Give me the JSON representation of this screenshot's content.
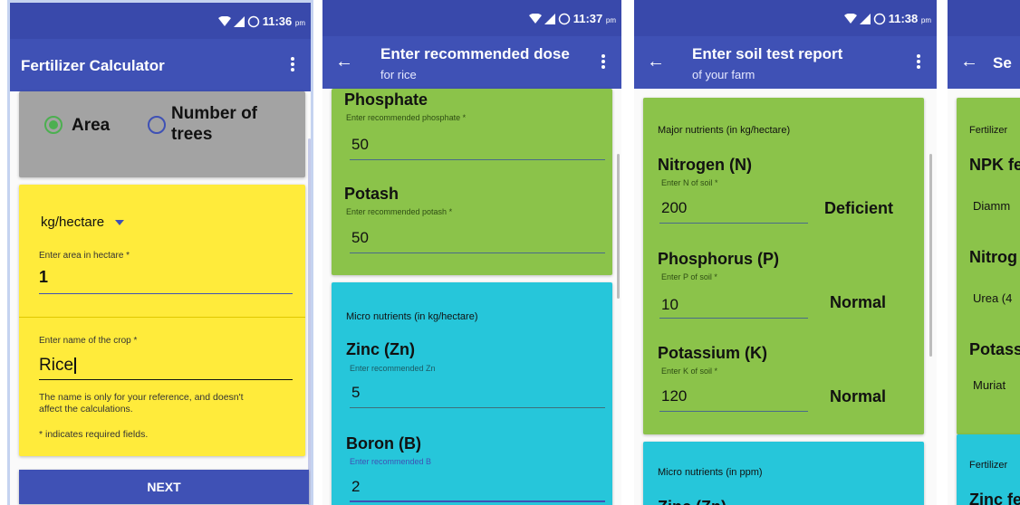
{
  "status": {
    "s1_time": "11:36",
    "s2_time": "11:37",
    "s3_time": "11:38",
    "ampm": "pm"
  },
  "screen1": {
    "title": "Fertilizer Calculator",
    "radio_area": "Area",
    "radio_trees_line1": "Number of",
    "radio_trees_line2": "trees",
    "unit_select": "kg/hectare",
    "area_label": "Enter area in hectare *",
    "area_value": "1",
    "crop_label": "Enter name of the crop *",
    "crop_value": "Rice",
    "note1_line1": "The name is only for your reference, and doesn't",
    "note1_line2": "affect the calculations.",
    "note2": "* indicates required fields.",
    "next_button": "NEXT"
  },
  "screen2": {
    "title": "Enter recommended dose",
    "subtitle": "for rice",
    "phosphate_heading": "Phosphate",
    "phosphate_label": "Enter recommended phosphate *",
    "phosphate_value": "50",
    "potash_heading": "Potash",
    "potash_label": "Enter recommended potash *",
    "potash_value": "50",
    "micro_heading": "Micro nutrients (in kg/hectare)",
    "zinc_heading": "Zinc (Zn)",
    "zinc_label": "Enter recommended Zn",
    "zinc_value": "5",
    "boron_heading": "Boron (B)",
    "boron_label": "Enter recommended B",
    "boron_value": "2"
  },
  "screen3": {
    "title": "Enter soil test report",
    "subtitle": "of your farm",
    "major_heading": "Major nutrients (in kg/hectare)",
    "n_heading": "Nitrogen (N)",
    "n_label": "Enter N of soil *",
    "n_value": "200",
    "n_status": "Deficient",
    "p_heading": "Phosphorus (P)",
    "p_label": "Enter P of soil *",
    "p_value": "10",
    "p_status": "Normal",
    "k_heading": "Potassium (K)",
    "k_label": "Enter K of soil *",
    "k_value": "120",
    "k_status": "Normal",
    "micro_heading": "Micro nutrients (in ppm)",
    "micro_partial": "Zinc (Zn)"
  },
  "screen4": {
    "title_partial": "Se",
    "card1_label": "Fertilizer",
    "npk_heading": "NPK fe",
    "diamm": "Diamm",
    "nitrog": "Nitrog",
    "urea": "Urea (4",
    "potass": "Potass",
    "muriat": "Muriat",
    "card2_label": "Fertilizer",
    "zinc_partial": "Zinc fe"
  }
}
